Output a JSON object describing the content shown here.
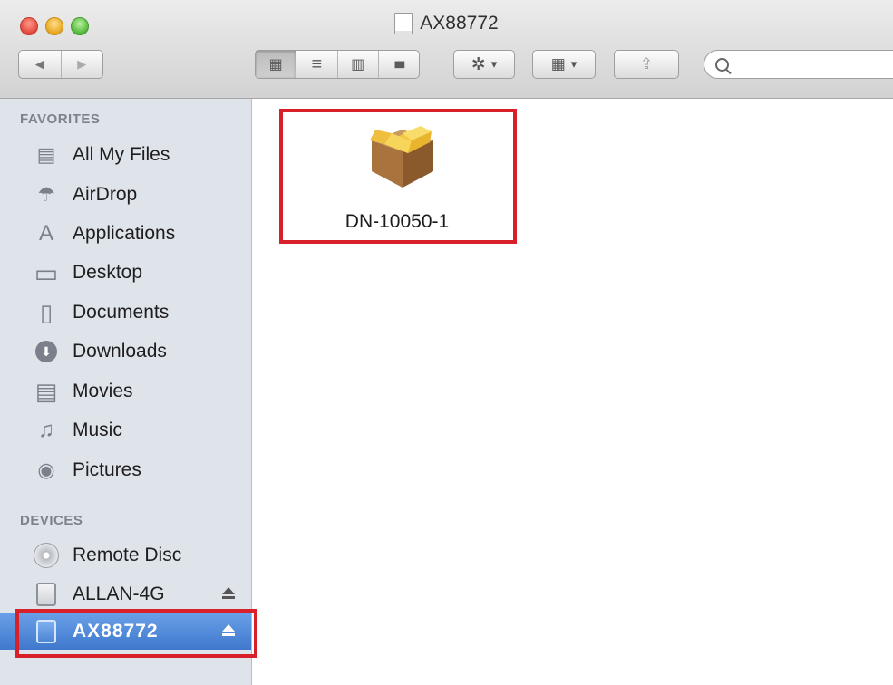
{
  "window": {
    "title": "AX88772"
  },
  "toolbar": {
    "back_glyph": "◀",
    "forward_glyph": "▶",
    "view_modes": [
      {
        "name": "icon-view",
        "glyph": "▦"
      },
      {
        "name": "list-view",
        "glyph": "≡"
      },
      {
        "name": "column-view",
        "glyph": "▥"
      },
      {
        "name": "coverflow-view",
        "glyph": "▮▮▮"
      }
    ],
    "action_glyph": "✲",
    "arrange_glyph": "▦",
    "dropdown_glyph": "▾",
    "share_glyph": "⇪",
    "search_placeholder": ""
  },
  "sidebar": {
    "favorites_header": "FAVORITES",
    "favorites": [
      {
        "label": "All My Files",
        "icon": "all-files-icon",
        "glyph": "▤"
      },
      {
        "label": "AirDrop",
        "icon": "airdrop-icon",
        "glyph": "☂"
      },
      {
        "label": "Applications",
        "icon": "applications-icon",
        "glyph": "A"
      },
      {
        "label": "Desktop",
        "icon": "desktop-icon",
        "glyph": "▭"
      },
      {
        "label": "Documents",
        "icon": "documents-icon",
        "glyph": "▯"
      },
      {
        "label": "Downloads",
        "icon": "downloads-icon",
        "glyph": "⬇"
      },
      {
        "label": "Movies",
        "icon": "movies-icon",
        "glyph": "▤"
      },
      {
        "label": "Music",
        "icon": "music-icon",
        "glyph": "♫"
      },
      {
        "label": "Pictures",
        "icon": "pictures-icon",
        "glyph": "◉"
      }
    ],
    "devices_header": "DEVICES",
    "devices": [
      {
        "label": "Remote Disc",
        "icon": "remote-disc-icon",
        "eject": false,
        "selected": false
      },
      {
        "label": "ALLAN-4G",
        "icon": "drive-icon",
        "eject": true,
        "selected": false
      },
      {
        "label": "AX88772",
        "icon": "drive-icon",
        "eject": true,
        "selected": true
      }
    ]
  },
  "main": {
    "files": [
      {
        "label": "DN-10050-1",
        "icon": "package-icon"
      }
    ]
  },
  "colors": {
    "highlight_box": "#d8202a",
    "selection": "#4a82d4",
    "sidebar_bg": "#dfe3ea"
  }
}
